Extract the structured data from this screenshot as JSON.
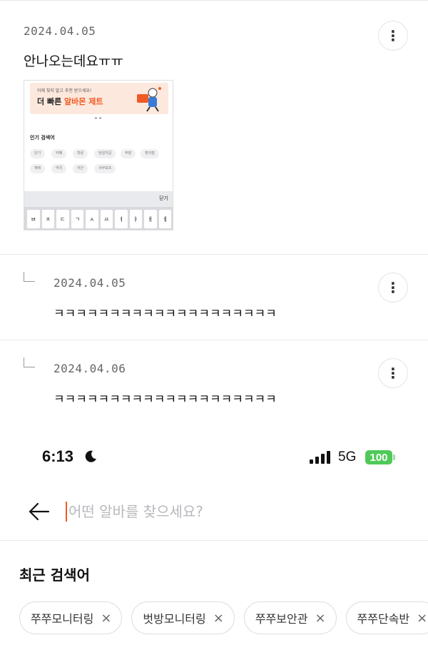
{
  "posts": [
    {
      "date": "2024.04.05",
      "text": "안나오는데요ㅠㅠ"
    },
    {
      "date": "2024.04.05",
      "text": "ㅋㅋㅋㅋㅋㅋㅋㅋㅋㅋㅋㅋㅋㅋㅋㅋㅋㅋㅋㅋ"
    },
    {
      "date": "2024.04.06",
      "text": "ㅋㅋㅋㅋㅋㅋㅋㅋㅋㅋㅋㅋㅋㅋㅋㅋㅋㅋㅋㅋ"
    }
  ],
  "more_icon": "⋮",
  "attachment": {
    "banner_small": "이제 찾지 말고 추천 받으세요!",
    "banner_big_pre": "더 빠른 ",
    "banner_big_accent": "알바몬 제트",
    "popular_title": "인기 검색어",
    "popular_chips": [
      "단기",
      "카페",
      "학원",
      "당일지급",
      "주말",
      "편의점",
      "재택",
      "약국",
      "야간",
      "사무보조"
    ],
    "keyboard_close": "닫기",
    "keyboard_keys": [
      "ㅂ",
      "ㅈ",
      "ㄷ",
      "ㄱ",
      "ㅅ",
      "ㅛ",
      "ㅕ",
      "ㅑ",
      "ㅐ",
      "ㅔ"
    ]
  },
  "status_bar": {
    "time": "6:13",
    "network": "5G",
    "battery": "100"
  },
  "search": {
    "placeholder": "어떤 알바를 찾으세요?"
  },
  "recent": {
    "title": "최근 검색어",
    "items": [
      "쭈쭈모니터링",
      "벗방모니터링",
      "쭈쭈보안관",
      "쭈쭈단속반"
    ],
    "remove_icon": "×"
  },
  "colors": {
    "accent": "#f05a24",
    "battery_green": "#4fca5a"
  }
}
